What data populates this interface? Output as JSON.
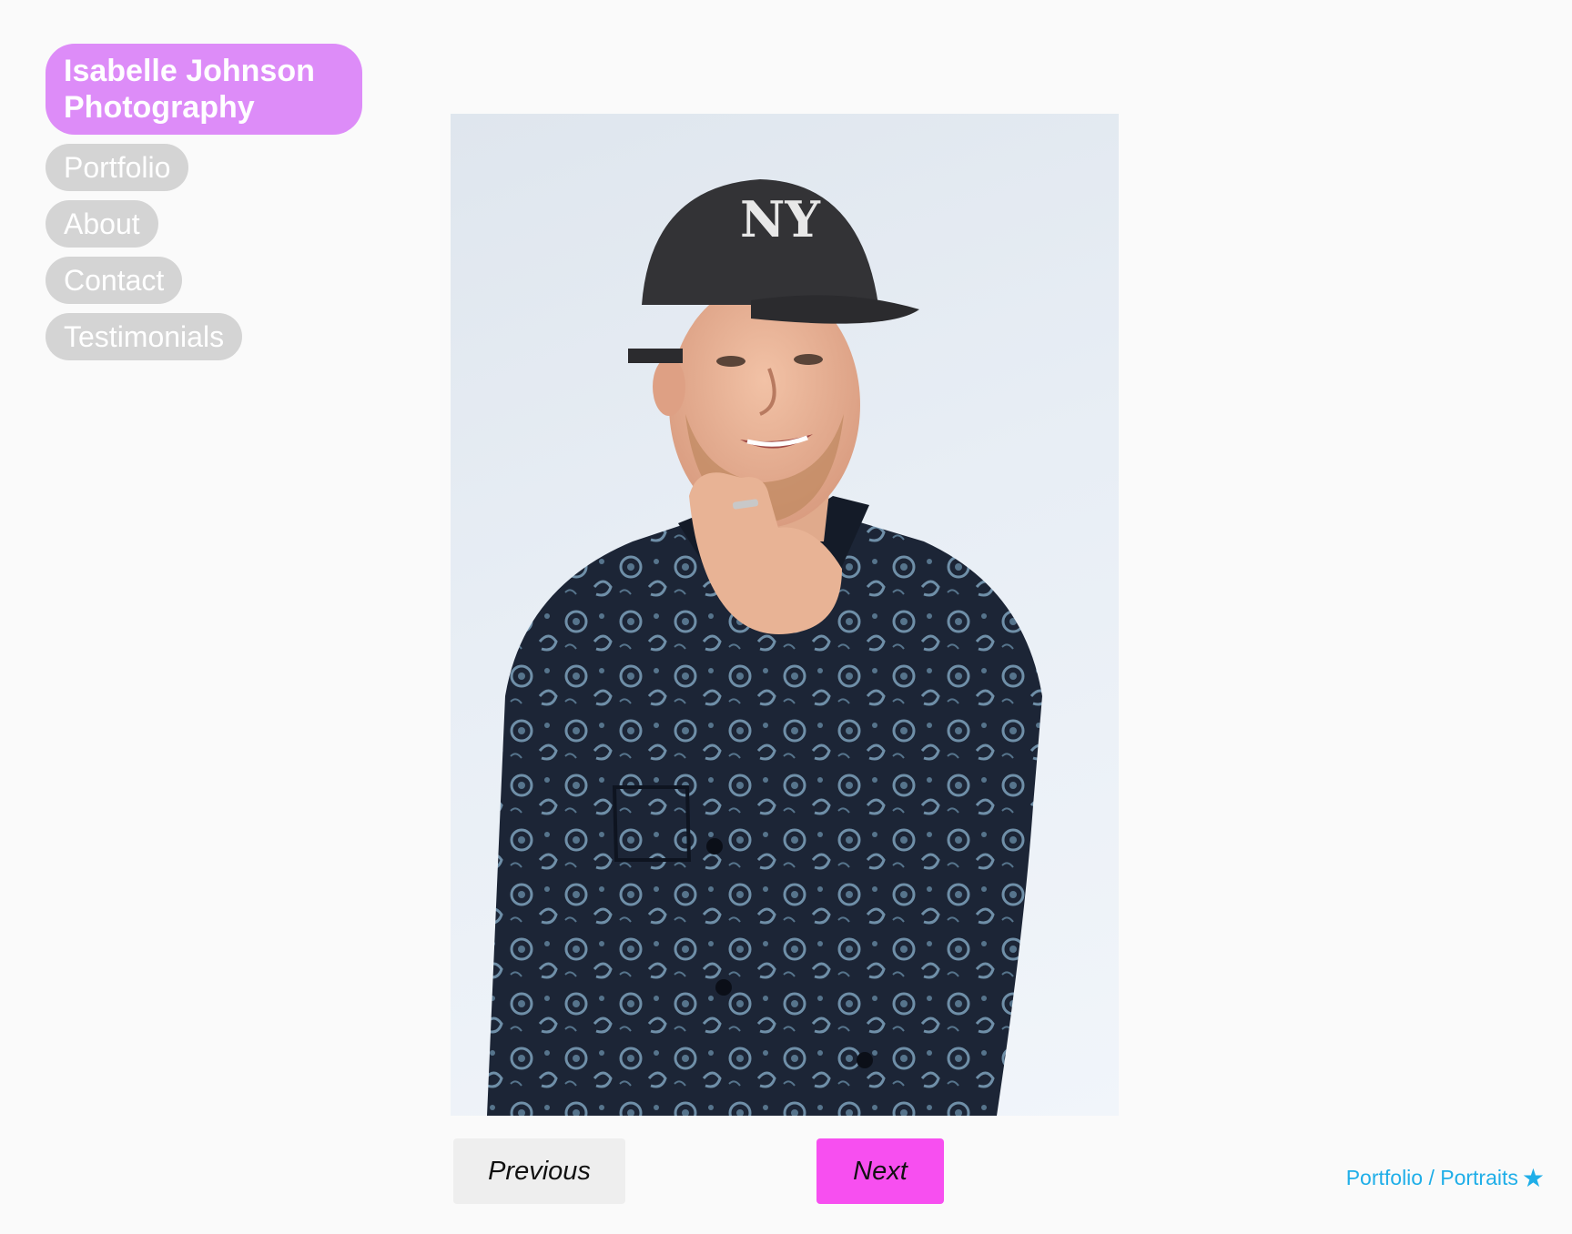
{
  "brand": {
    "line1": "Isabelle Johnson",
    "line2": "Photography",
    "color": "#dd8cf8"
  },
  "nav": {
    "items": [
      {
        "label": "Portfolio"
      },
      {
        "label": "About"
      },
      {
        "label": "Contact"
      },
      {
        "label": "Testimonials"
      }
    ],
    "pill_color": "#d4d4d4"
  },
  "photo": {
    "cap_logo": "NY"
  },
  "pager": {
    "previous_label": "Previous",
    "next_label": "Next",
    "next_color": "#f74ff0"
  },
  "breadcrumb": {
    "section": "Portfolio",
    "separator": " / ",
    "page": "Portraits",
    "icon": "star-icon",
    "color": "#1faee8"
  }
}
